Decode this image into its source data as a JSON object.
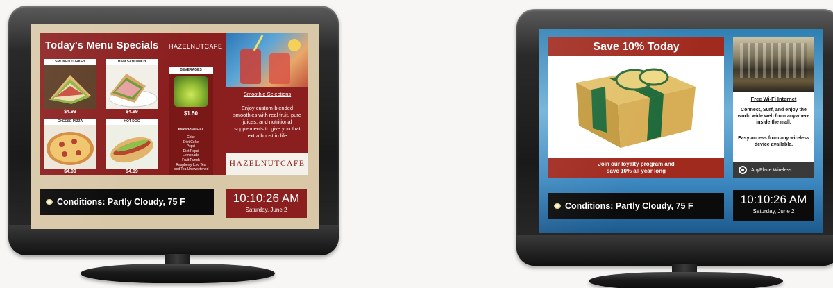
{
  "cafe_display": {
    "menu": {
      "title": "Today's Menu Specials",
      "brand": "HAZELNUTCAFE",
      "items": [
        {
          "name": "SMOKED TURKEY",
          "price": "$4.99",
          "icon": "sandwich-photo"
        },
        {
          "name": "HAM SANDWICH",
          "price": "$4.99",
          "icon": "sandwich-photo"
        },
        {
          "name": "CHEESE PIZZA",
          "price": "$4.99",
          "icon": "pizza-photo"
        },
        {
          "name": "HOT DOG",
          "price": "$4.99",
          "icon": "hotdog-photo"
        }
      ],
      "beverages": {
        "name": "BEVERAGES",
        "price": "$1.50",
        "list_title": "BEVERAGE LIST",
        "list": [
          "Coke",
          "Diet Coke",
          "Pepsi",
          "Diet Pepsi",
          "Lemonade",
          "Fruit Punch",
          "Raspberry Iced Tea",
          "Iced Tea Unsweetened"
        ]
      }
    },
    "smoothie": {
      "heading": "Smoothie Selections",
      "text": "Enjoy custom-blended smoothies with real fruit, pure juices, and nutritional supplements to give you that extra boost in life",
      "brand": "HAZELNUTCAFE"
    },
    "conditions": "Conditions: Partly Cloudy, 75 F",
    "clock": {
      "time": "10:10:26 AM",
      "date": "Saturday, June 2"
    },
    "colors": {
      "panel": "#8b1e1e",
      "background": "#d9c8a8"
    }
  },
  "mall_display": {
    "promo": {
      "headline": "Save 10% Today",
      "footer_line1": "Join our loyalty program and",
      "footer_line2": "save 10% all year long"
    },
    "wifi": {
      "heading": "Free Wi-Fi Internet",
      "text1": "Connect, Surf, and enjoy the world wide web from anywhere inside the mall.",
      "text2": "Easy access from any wireless device available.",
      "brand": "AnyPlace Wireless"
    },
    "conditions": "Conditions: Partly Cloudy, 75 F",
    "clock": {
      "time": "10:10:26 AM",
      "date": "Saturday, June 2"
    },
    "colors": {
      "panel": "#a12a1f",
      "background": "#3c87bf"
    }
  }
}
